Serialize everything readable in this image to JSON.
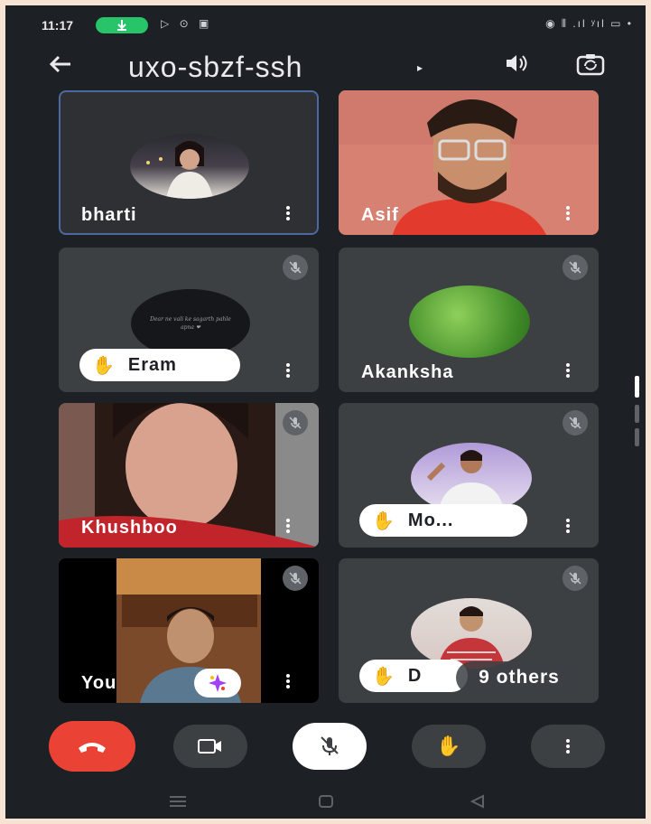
{
  "status_bar": {
    "time": "11:17",
    "pill_icon": "download-arrow",
    "left_icons": "▷ ⊙ ▣",
    "right_icons": "◉ ⫴ .ıl ʸıl ▭ •"
  },
  "header": {
    "title": "uxo-sbzf-ssh",
    "back_icon": "arrow-left",
    "caret": "▸",
    "speaker_icon": "speaker-icon",
    "switch_camera_icon": "switch-camera-icon"
  },
  "participants": [
    {
      "name": "bharti"
    },
    {
      "name": "Asif"
    },
    {
      "name": "Eram"
    },
    {
      "name": "Akanksha"
    },
    {
      "name": "Khushboo"
    },
    {
      "name": "Mo..."
    },
    {
      "name": "You"
    },
    {
      "name": "D"
    }
  ],
  "others_label": "9 others",
  "tile_texts": {
    "eram_avatar_text": "Dear ne vali ke sagarth pahle apna ❤"
  },
  "controls": {
    "end_call_icon": "phone-hangup-icon",
    "camera_icon": "video-camera-icon",
    "mic_icon": "mic-off-icon",
    "hand_icon": "raise-hand-icon",
    "more_icon": "more-vert-icon"
  },
  "colors": {
    "background": "#1d2024",
    "tile": "#3c4043",
    "end_call": "#ea4335",
    "active_border": "#4b6aa0"
  }
}
